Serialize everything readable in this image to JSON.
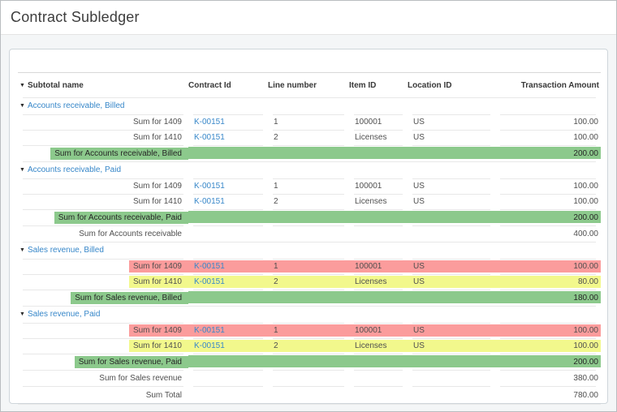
{
  "page": {
    "title": "Contract Subledger"
  },
  "icons": {
    "collapse_caret": "▼",
    "sort_caret": "▼"
  },
  "colors": {
    "highlight_red": "#fb9c9c",
    "highlight_yellow": "#f2f88c",
    "highlight_green": "#8cc98c",
    "link_blue": "#3787c9"
  },
  "table": {
    "columns": [
      {
        "label": "Subtotal name",
        "sort_caret": true
      },
      {
        "label": "Contract Id"
      },
      {
        "label": "Line number"
      },
      {
        "label": "Item ID"
      },
      {
        "label": "Location ID"
      },
      {
        "label": "Transaction Amount"
      }
    ],
    "rows": [
      {
        "type": "group",
        "label": "Accounts receivable, Billed"
      },
      {
        "type": "data",
        "highlight": "none",
        "cells": [
          "Sum for 1409",
          "K-00151",
          "1",
          "100001",
          "US",
          "100.00"
        ]
      },
      {
        "type": "data",
        "highlight": "none",
        "cells": [
          "Sum for 1410",
          "K-00151",
          "2",
          "Licenses",
          "US",
          "100.00"
        ]
      },
      {
        "type": "subtotal_highlight",
        "label": "Sum for Accounts receivable, Billed",
        "amount": "200.00"
      },
      {
        "type": "group",
        "label": "Accounts receivable, Paid"
      },
      {
        "type": "data",
        "highlight": "none",
        "cells": [
          "Sum for 1409",
          "K-00151",
          "1",
          "100001",
          "US",
          "100.00"
        ]
      },
      {
        "type": "data",
        "highlight": "none",
        "cells": [
          "Sum for 1410",
          "K-00151",
          "2",
          "Licenses",
          "US",
          "100.00"
        ]
      },
      {
        "type": "subtotal_highlight",
        "label": "Sum for Accounts receivable, Paid",
        "amount": "200.00"
      },
      {
        "type": "subtotal",
        "label": "Sum for Accounts receivable",
        "amount": "400.00"
      },
      {
        "type": "group",
        "label": "Sales revenue, Billed"
      },
      {
        "type": "data",
        "highlight": "red",
        "cells": [
          "Sum for 1409",
          "K-00151",
          "1",
          "100001",
          "US",
          "100.00"
        ]
      },
      {
        "type": "data",
        "highlight": "yellow",
        "cells": [
          "Sum for 1410",
          "K-00151",
          "2",
          "Licenses",
          "US",
          "80.00"
        ]
      },
      {
        "type": "subtotal_highlight",
        "label": "Sum for Sales revenue, Billed",
        "amount": "180.00"
      },
      {
        "type": "group",
        "label": "Sales revenue, Paid"
      },
      {
        "type": "data",
        "highlight": "red",
        "cells": [
          "Sum for 1409",
          "K-00151",
          "1",
          "100001",
          "US",
          "100.00"
        ]
      },
      {
        "type": "data",
        "highlight": "yellow",
        "cells": [
          "Sum for 1410",
          "K-00151",
          "2",
          "Licenses",
          "US",
          "100.00"
        ]
      },
      {
        "type": "subtotal_highlight",
        "label": "Sum for Sales revenue, Paid",
        "amount": "200.00"
      },
      {
        "type": "subtotal",
        "label": "Sum for Sales revenue",
        "amount": "380.00"
      },
      {
        "type": "total",
        "label": "Sum Total",
        "amount": "780.00"
      }
    ]
  }
}
